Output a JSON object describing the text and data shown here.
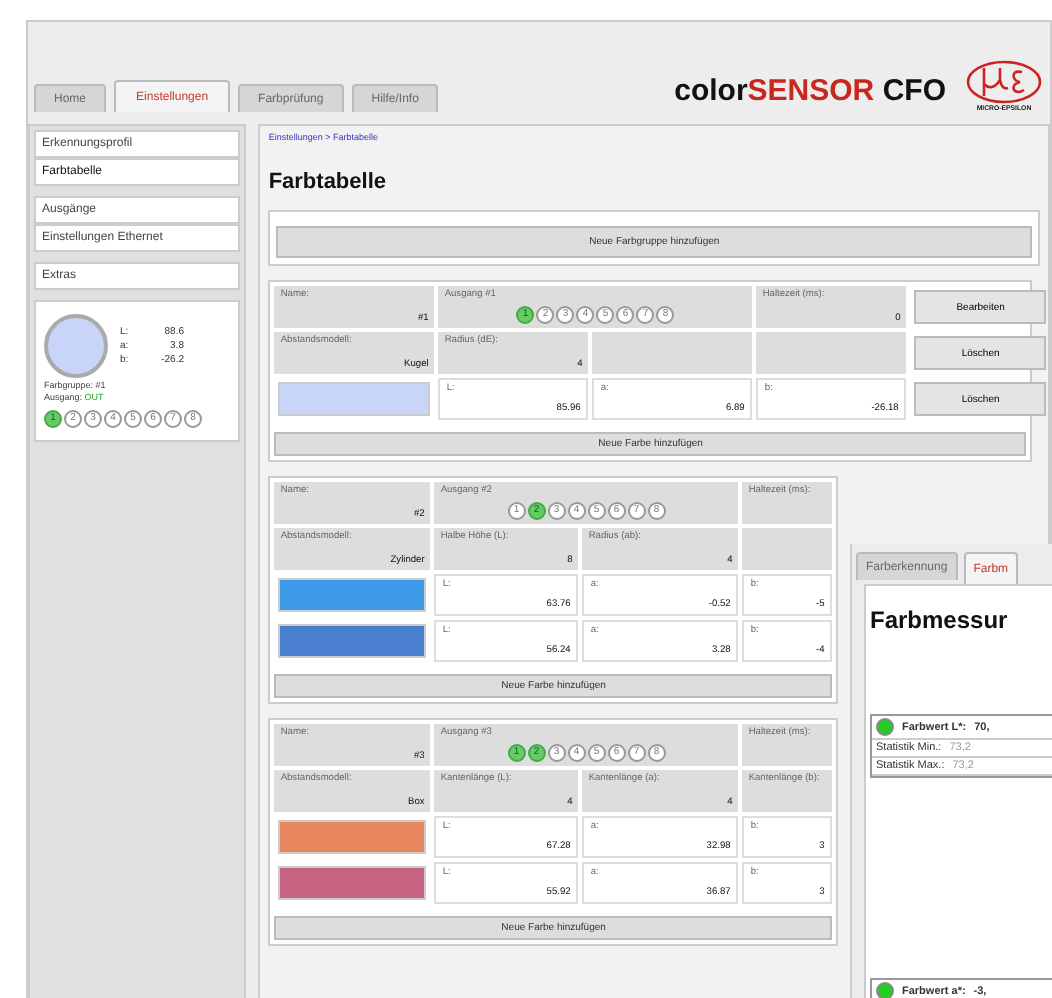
{
  "brand": {
    "prefix": "color",
    "highlight": "SENSOR",
    "suffix": " CFO",
    "logo": "MICRO-EPSILON"
  },
  "tabs": [
    {
      "label": "Home",
      "selected": false
    },
    {
      "label": "Einstellungen",
      "selected": true
    },
    {
      "label": "Farbprüfung",
      "selected": false
    },
    {
      "label": "Hilfe/Info",
      "selected": false
    }
  ],
  "sidebar": {
    "groups": [
      [
        {
          "label": "Erkennungsprofil",
          "selected": false
        },
        {
          "label": "Farbtabelle",
          "selected": true
        }
      ],
      [
        {
          "label": "Ausgänge",
          "selected": false
        },
        {
          "label": "Einstellungen Ethernet",
          "selected": false
        }
      ],
      [
        {
          "label": "Extras",
          "selected": false
        }
      ]
    ],
    "widget": {
      "color": "#c8d4f8",
      "values": [
        {
          "label": "L:",
          "value": "88.6"
        },
        {
          "label": "a:",
          "value": "3.8"
        },
        {
          "label": "b:",
          "value": "-26.2"
        }
      ],
      "group": "Farbgruppe: #1",
      "output_label": "Ausgang:",
      "output_value": "OUT",
      "outputs": [
        {
          "label": "1",
          "on": true
        },
        {
          "label": "2",
          "on": false
        },
        {
          "label": "3",
          "on": false
        },
        {
          "label": "4",
          "on": false
        },
        {
          "label": "5",
          "on": false
        },
        {
          "label": "6",
          "on": false
        },
        {
          "label": "7",
          "on": false
        },
        {
          "label": "8",
          "on": false
        }
      ]
    }
  },
  "breadcrumb": "Einstellungen > Farbtabelle",
  "title": "Farbtabelle",
  "add_group_button": "Neue Farbgruppe hinzufügen",
  "groups": [
    {
      "name_label": "Name:",
      "name": "#1",
      "output_label": "Ausgang #1",
      "outputs": [
        {
          "label": "1",
          "on": true
        },
        {
          "label": "2",
          "on": false
        },
        {
          "label": "3",
          "on": false
        },
        {
          "label": "4",
          "on": false
        },
        {
          "label": "5",
          "on": false
        },
        {
          "label": "6",
          "on": false
        },
        {
          "label": "7",
          "on": false
        },
        {
          "label": "8",
          "on": false
        }
      ],
      "hold_label": "Haltezeit (ms):",
      "hold": "0",
      "model_label": "Abstandsmodell:",
      "model": "Kugel",
      "params": [
        {
          "label": "Radius (dE):",
          "value": "4"
        }
      ],
      "edit_button": "Bearbeiten",
      "delete_button": "Löschen",
      "colors": [
        {
          "color": "#c8d4f8",
          "L_label": "L:",
          "L": "85.96",
          "a_label": "a:",
          "a": "6.89",
          "b_label": "b:",
          "b": "-26.18",
          "delete_button": "Löschen"
        }
      ],
      "add_color_button": "Neue Farbe hinzufügen"
    },
    {
      "name_label": "Name:",
      "name": "#2",
      "output_label": "Ausgang #2",
      "outputs": [
        {
          "label": "1",
          "on": false
        },
        {
          "label": "2",
          "on": true
        },
        {
          "label": "3",
          "on": false
        },
        {
          "label": "4",
          "on": false
        },
        {
          "label": "5",
          "on": false
        },
        {
          "label": "6",
          "on": false
        },
        {
          "label": "7",
          "on": false
        },
        {
          "label": "8",
          "on": false
        }
      ],
      "hold_label": "Haltezeit (ms):",
      "model_label": "Abstandsmodell:",
      "model": "Zylinder",
      "params": [
        {
          "label": "Halbe Höhe (L):",
          "value": "8"
        },
        {
          "label": "Radius (ab):",
          "value": "4"
        }
      ],
      "colors": [
        {
          "color": "#3d9be9",
          "L_label": "L:",
          "L": "63.76",
          "a_label": "a:",
          "a": "-0.52",
          "b_label": "b:",
          "b": "-5"
        },
        {
          "color": "#4a7fd0",
          "L_label": "L:",
          "L": "56.24",
          "a_label": "a:",
          "a": "3.28",
          "b_label": "b:",
          "b": "-4"
        }
      ],
      "add_color_button": "Neue Farbe hinzufügen"
    },
    {
      "name_label": "Name:",
      "name": "#3",
      "output_label": "Ausgang #3",
      "outputs": [
        {
          "label": "1",
          "on": true
        },
        {
          "label": "2",
          "on": true
        },
        {
          "label": "3",
          "on": false
        },
        {
          "label": "4",
          "on": false
        },
        {
          "label": "5",
          "on": false
        },
        {
          "label": "6",
          "on": false
        },
        {
          "label": "7",
          "on": false
        },
        {
          "label": "8",
          "on": false
        }
      ],
      "hold_label": "Haltezeit (ms):",
      "model_label": "Abstandsmodell:",
      "model": "Box",
      "params": [
        {
          "label": "Kantenlänge (L):",
          "value": "4"
        },
        {
          "label": "Kantenlänge (a):",
          "value": "4"
        },
        {
          "label": "Kantenlänge (b):"
        }
      ],
      "colors": [
        {
          "color": "#e8865e",
          "L_label": "L:",
          "L": "67.28",
          "a_label": "a:",
          "a": "32.98",
          "b_label": "b:",
          "b": "3"
        },
        {
          "color": "#c86482",
          "L_label": "L:",
          "L": "55.92",
          "a_label": "a:",
          "a": "36.87",
          "b_label": "b:",
          "b": "3"
        }
      ],
      "add_color_button": "Neue Farbe hinzufügen"
    }
  ],
  "second_window": {
    "tabs": [
      {
        "label": "Farberkennung",
        "selected": false
      },
      {
        "label": "Farbm",
        "selected": true
      }
    ],
    "title": "Farbmessur",
    "blocks": [
      {
        "rows": [
          {
            "kind": "value",
            "label": "Farbwert L*:",
            "value": "70,",
            "on": true
          },
          {
            "kind": "stat",
            "label": "Statistik Min.:",
            "value": "73,2"
          },
          {
            "kind": "stat",
            "label": "Statistik Max.:",
            "value": "73,2"
          }
        ]
      },
      {
        "rows": [
          {
            "kind": "value",
            "label": "Farbwert a*:",
            "value": "-3,",
            "on": true
          }
        ]
      }
    ]
  }
}
